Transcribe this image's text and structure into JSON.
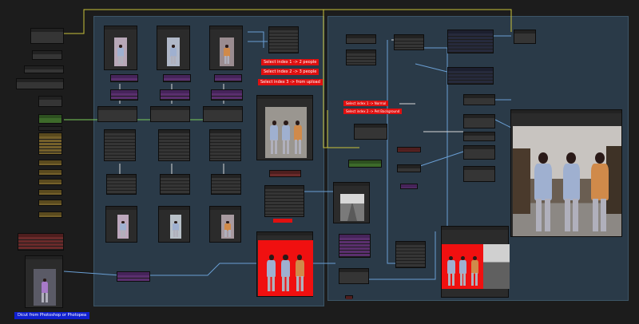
{
  "groups": {
    "left": {
      "title": ""
    },
    "right": {
      "title": ""
    }
  },
  "notes": {
    "select_2": "Select index 1 -> 2 people",
    "select_3": "Select index 2 -> 3 people",
    "select_upload": "Select index 3 -> from upload",
    "select_normal": "Select index 1 -> Normal",
    "select_bg": "Select index 2 -> Pet Background",
    "save_label": "",
    "dicut": "Dicut from Photoshop or Photopea"
  },
  "colors": {
    "background": "#1c1c1c",
    "group_fill": "#2a3a48",
    "node": "#353535",
    "purple_node": "#5a2f6e",
    "green_node": "#3d6a2a",
    "yellow_node": "#74602a",
    "red_note": "#e01010",
    "blue_note": "#1020d0",
    "wire_yellow": "#c9c23a",
    "wire_blue": "#6a9fd4",
    "wire_green": "#7acc5a"
  },
  "icons": {
    "character_preview": "three-figure-image",
    "red_background_preview": "red-background-three-figure-image",
    "street_preview": "street-photo-image",
    "upload_preview": "single-figure-image"
  }
}
